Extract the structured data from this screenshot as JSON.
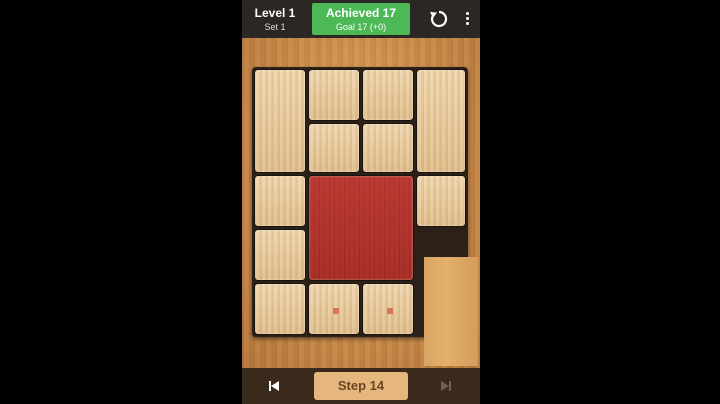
{
  "header": {
    "level_label": "Level 1",
    "set_label": "Set 1",
    "achieved_label": "Achieved 17",
    "goal_label": "Goal 17 (+0)",
    "icons": {
      "restart": "restart-icon",
      "menu": "more-vert-icon"
    }
  },
  "footer": {
    "step_label": "Step 14",
    "icons": {
      "prev": "skip-previous-icon",
      "next": "skip-next-icon"
    }
  },
  "colors": {
    "achieved_bg": "#4cb956",
    "target_block": "#b02f27",
    "wood_tile": "#e8c998",
    "board_frame": "#2b2118"
  }
}
